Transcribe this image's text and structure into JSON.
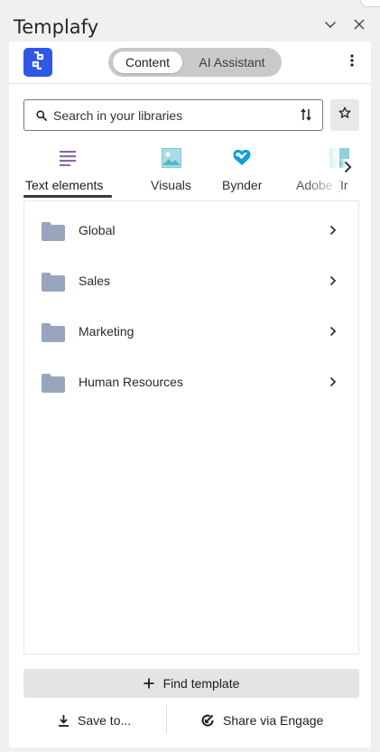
{
  "pane": {
    "title": "Templafy"
  },
  "app_bar": {
    "toggle": {
      "options": [
        "Content",
        "AI Assistant"
      ],
      "selected": "Content"
    }
  },
  "search": {
    "placeholder": "Search in your libraries",
    "value": ""
  },
  "tabs": [
    {
      "label": "Text elements",
      "icon": "text-lines-icon",
      "active": true
    },
    {
      "label": "Visuals",
      "icon": "image-icon",
      "active": false
    },
    {
      "label": "Bynder",
      "icon": "bynder-logo-icon",
      "active": false
    },
    {
      "label": "Adobe (Ir",
      "icon": "image-icon",
      "active": false
    }
  ],
  "folders": [
    {
      "label": "Global"
    },
    {
      "label": "Sales"
    },
    {
      "label": "Marketing"
    },
    {
      "label": "Human Resources"
    }
  ],
  "actions": {
    "find_template": "Find template",
    "save_to": "Save to...",
    "share": "Share via Engage"
  },
  "colors": {
    "brand_blue": "#2f57e8",
    "folder": "#97a6bd",
    "text_elements_icon": "#8a6aa0",
    "visuals_icon": "#56b5c6",
    "bynder_icon": "#0d9fdc"
  }
}
